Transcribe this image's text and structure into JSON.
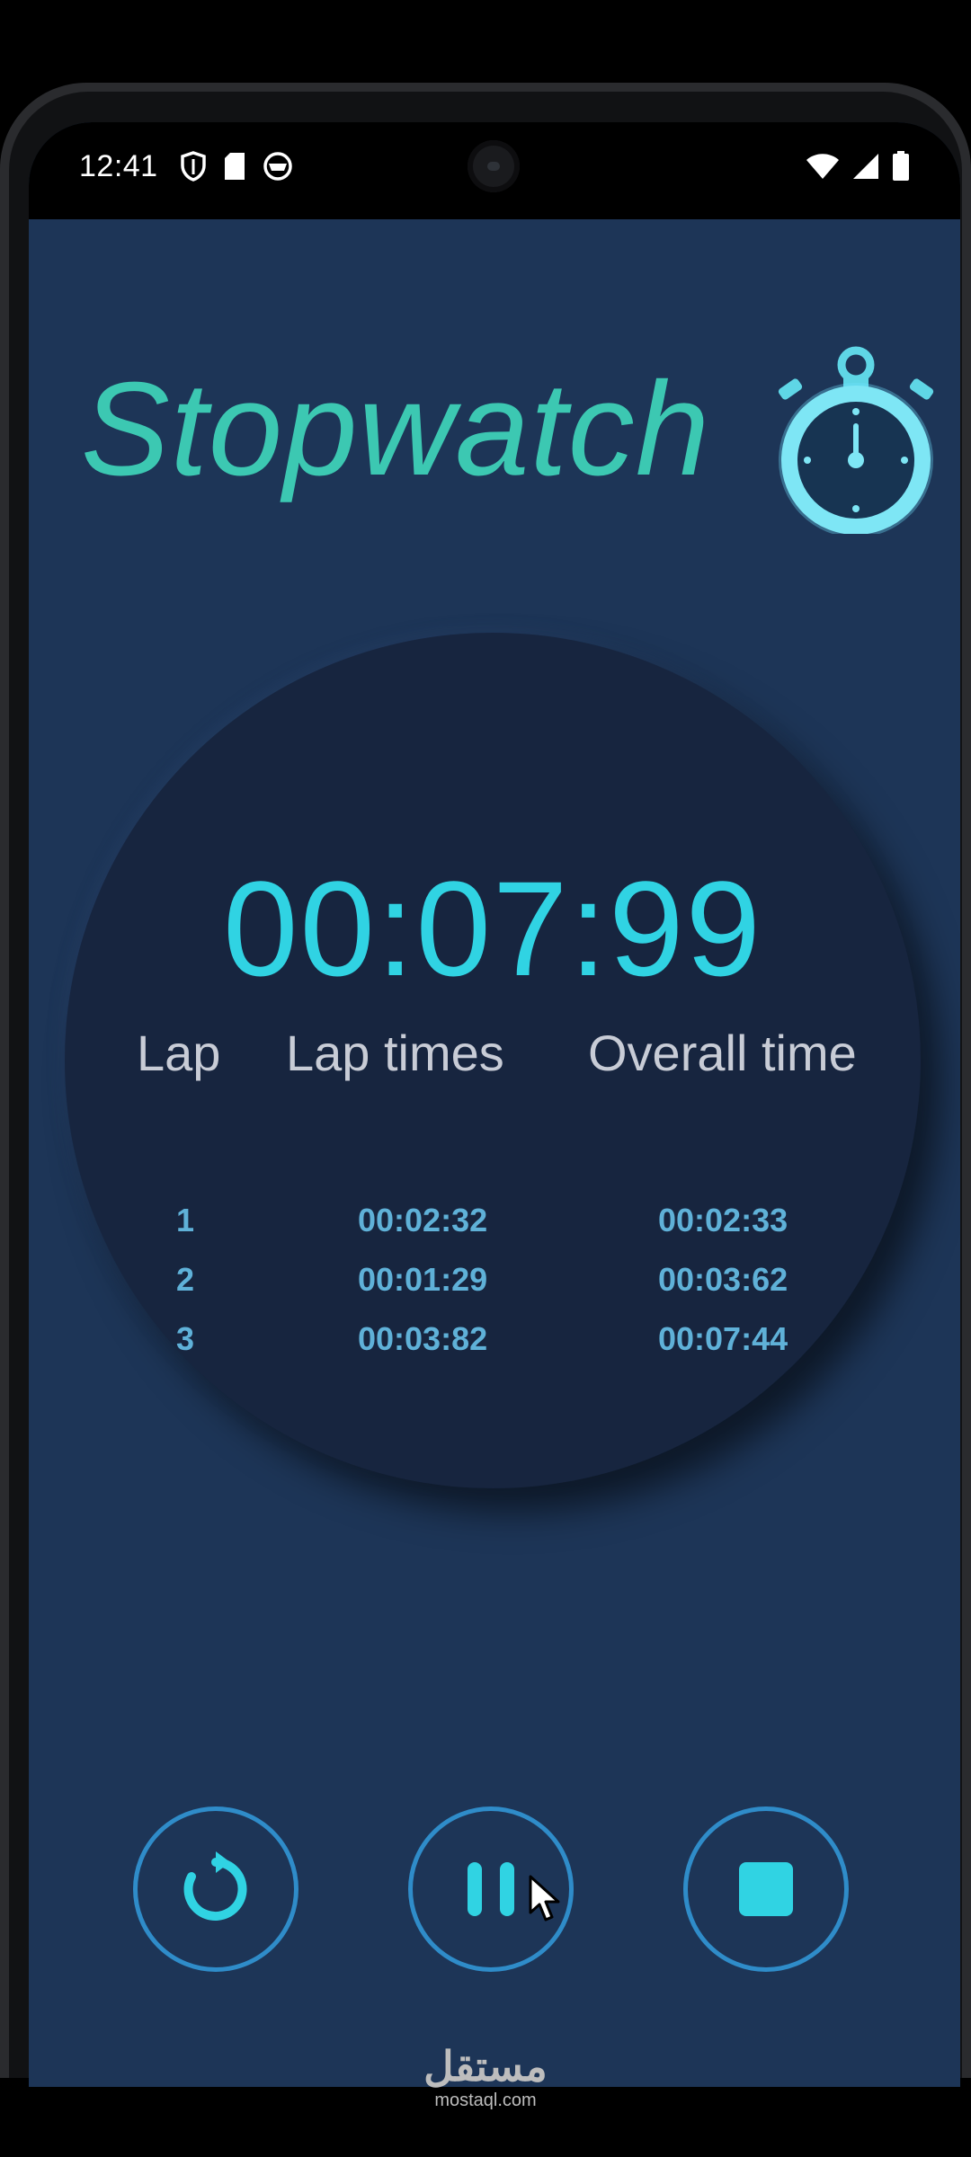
{
  "status_bar": {
    "time": "12:41",
    "left_icons": [
      "shield-icon",
      "sim-card-icon",
      "app-notification-icon"
    ],
    "right_icons": [
      "wifi-icon",
      "signal-icon",
      "battery-icon"
    ]
  },
  "app": {
    "title": "Stopwatch",
    "title_color": "#3cc8b2",
    "accent_color": "#30d3e3",
    "background_color": "#1d3557"
  },
  "timer": {
    "display": "00:07:99"
  },
  "laps": {
    "headers": [
      "Lap",
      "Lap times",
      "Overall time"
    ],
    "rows": [
      {
        "lap": "1",
        "lap_time": "00:02:32",
        "overall": "00:02:33"
      },
      {
        "lap": "2",
        "lap_time": "00:01:29",
        "overall": "00:03:62"
      },
      {
        "lap": "3",
        "lap_time": "00:03:82",
        "overall": "00:07:44"
      }
    ]
  },
  "controls": {
    "reset_icon": "reset-icon",
    "pause_icon": "pause-icon",
    "stop_icon": "stop-icon"
  },
  "watermark": {
    "logo": "مستقل",
    "domain": "mostaql.com"
  }
}
